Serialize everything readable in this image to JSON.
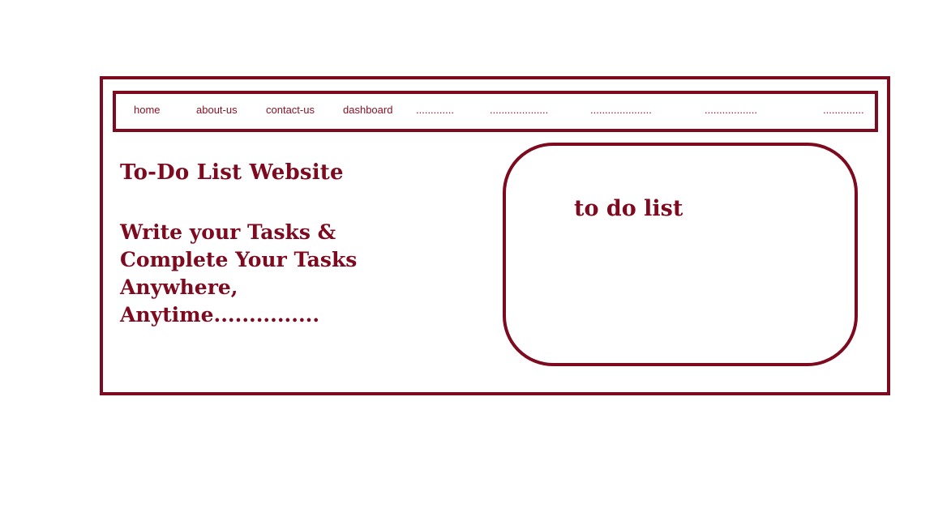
{
  "nav": {
    "items": [
      {
        "label": "home"
      },
      {
        "label": "about-us"
      },
      {
        "label": "contact-us"
      },
      {
        "label": "dashboard"
      },
      {
        "label": "............."
      },
      {
        "label": "...................."
      },
      {
        "label": "....................."
      },
      {
        "label": ".................."
      },
      {
        "label": ".............."
      }
    ]
  },
  "hero": {
    "title": "To-Do List Website",
    "tagline": "Write your Tasks & Complete Your Tasks Anywhere, Anytime..............."
  },
  "todo": {
    "title": "to do list"
  },
  "colors": {
    "accent": "#7d0a1e",
    "nav_text": "#8a1226",
    "background": "#ffffff"
  }
}
